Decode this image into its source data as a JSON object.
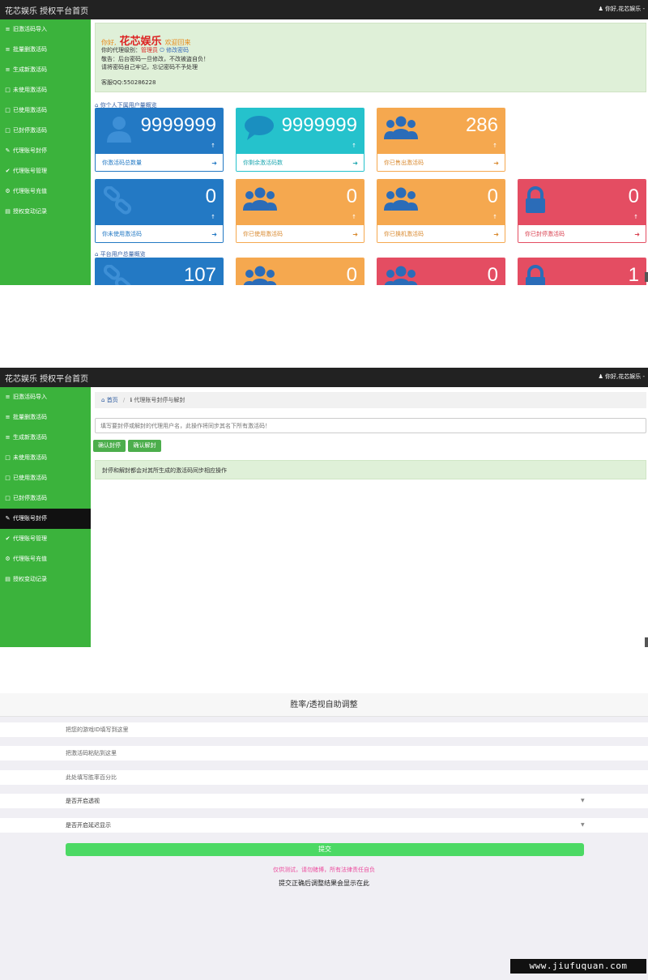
{
  "header": {
    "brand": "花芯娱乐 授权平台首页",
    "user_p1": "你好,花芯娱乐 -",
    "user_p2": "你好,花芯娱乐 -"
  },
  "sidebar": {
    "items": [
      {
        "icon": "list-icon",
        "label": "旧激活码导入"
      },
      {
        "icon": "list-icon",
        "label": "批量删激活码"
      },
      {
        "icon": "list-icon",
        "label": "生成新激活码"
      },
      {
        "icon": "file-icon",
        "label": "未使用激活码"
      },
      {
        "icon": "file-icon",
        "label": "已使用激活码"
      },
      {
        "icon": "file-icon",
        "label": "已封停激活码"
      },
      {
        "icon": "edit-icon",
        "label": "代理账号封停"
      },
      {
        "icon": "check-icon",
        "label": "代理账号管理"
      },
      {
        "icon": "gear-icon",
        "label": "代理账号充值"
      },
      {
        "icon": "record-icon",
        "label": "授权变动记录"
      }
    ]
  },
  "dashboard": {
    "welcome": {
      "hello": "你好,",
      "app_name": "花芯娱乐",
      "welcome_back": "欢迎回来",
      "level_label": "你的代理级别：",
      "level_value": "管理员",
      "change_pwd": "修改密码",
      "notice1": "敬告：后台密码一旦修改，不改被盗自负！",
      "notice2": "请将密码自己牢记，忘记密码不予处理",
      "support": "客服QQ:550286228"
    },
    "section1_title": "你个人下属用户量概览",
    "section2_title": "平台用户总量概览",
    "tiles_row1": [
      {
        "color": "blue",
        "icon": "person-icon",
        "value": "9999999",
        "label": "你激活码总数量"
      },
      {
        "color": "cyan",
        "icon": "comment-icon",
        "value": "9999999",
        "label": "你剩余激活码数"
      },
      {
        "color": "orange",
        "icon": "users-icon",
        "value": "286",
        "label": "你已售出激活码"
      }
    ],
    "tiles_row2": [
      {
        "color": "blue",
        "icon": "link-icon",
        "value": "0",
        "label": "你未使用激活码"
      },
      {
        "color": "orange",
        "icon": "users-icon",
        "value": "0",
        "label": "你已使用激活码"
      },
      {
        "color": "orange",
        "icon": "users-icon",
        "value": "0",
        "label": "你已换机激活码"
      },
      {
        "color": "red",
        "icon": "lock-icon",
        "value": "0",
        "label": "你已封停激活码"
      }
    ],
    "tiles_row3": [
      {
        "color": "blue",
        "icon": "link-icon",
        "value": "107"
      },
      {
        "color": "orange",
        "icon": "users-icon",
        "value": "0"
      },
      {
        "color": "red",
        "icon": "users-icon",
        "value": "0"
      },
      {
        "color": "red",
        "icon": "lock-icon",
        "value": "1"
      }
    ],
    "tile_arrow": "↑"
  },
  "ban_page": {
    "breadcrumb_home": "首页",
    "breadcrumb_sep": "/",
    "breadcrumb_current": "代理账号封停与解封",
    "input_placeholder": "填写要封停或解封的代理用户名，此操作将同步其名下所有激活码！",
    "ban_button": "确认封停",
    "unban_button": "确认解封",
    "note": "封停和解封都会对其所生成的激活码同步相应操作"
  },
  "adjust_page": {
    "title": "胜率/透视自助调整",
    "field_game_id": "把您的游戏ID填写到这里",
    "field_code": "把激活码粘贴到这里",
    "field_winrate": "此处填写胜率百分比",
    "select_vision": "是否开启透视",
    "select_delay": "是否开启延迟显示",
    "submit": "提交",
    "warning": "仅供测试，请勿赌博，所有法律责任自负",
    "result": "提交正确后调整结果会显示在此"
  },
  "watermark": "www.jiufuquan.com"
}
